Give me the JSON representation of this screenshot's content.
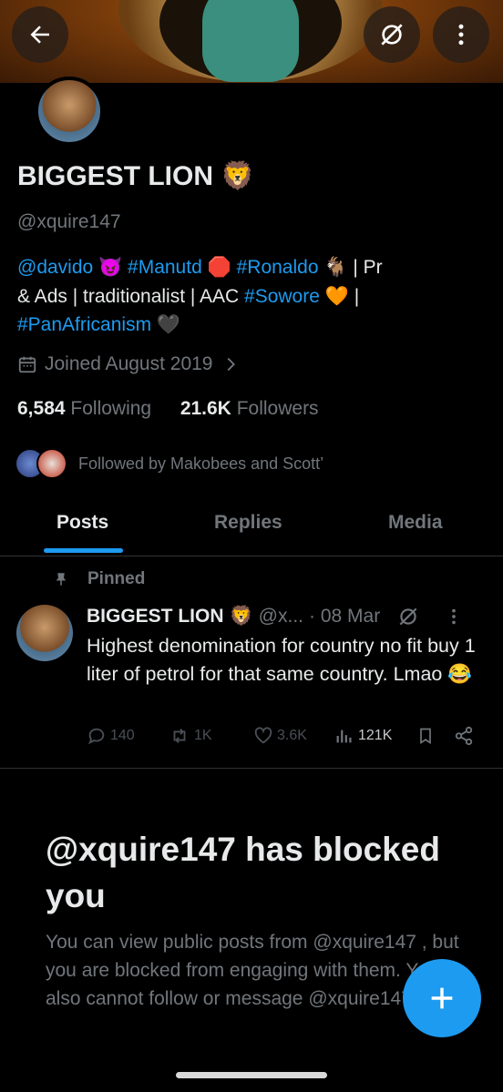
{
  "banner": {
    "back_icon": "arrow-left-icon",
    "hide_icon": "eye-slash-icon",
    "more_icon": "more-vertical-icon"
  },
  "profile": {
    "name": "BIGGEST LION",
    "name_emoji": "🦁",
    "handle": "@xquire147",
    "bio": {
      "line1": [
        {
          "t": "@davido",
          "link": true
        },
        {
          "t": " 😈 ",
          "link": false
        },
        {
          "t": "#Manutd",
          "link": true
        },
        {
          "t": " 🛑 ",
          "link": false
        },
        {
          "t": "#Ronaldo",
          "link": true
        },
        {
          "t": " 🐐 | Pr",
          "link": false
        }
      ],
      "line2": [
        {
          "t": "& Ads | traditionalist | AAC ",
          "link": false
        },
        {
          "t": "#Sowore",
          "link": true
        },
        {
          "t": " 🧡 |",
          "link": false
        }
      ],
      "line3": [
        {
          "t": "#PanAfricanism",
          "link": true
        },
        {
          "t": " 🖤",
          "link": false
        }
      ]
    },
    "joined": "Joined August 2019",
    "following_count": "6,584",
    "following_label": "Following",
    "followers_count": "21.6K",
    "followers_label": "Followers",
    "followed_by": "Followed by Makobees and Scott’"
  },
  "tabs": {
    "posts": "Posts",
    "replies": "Replies",
    "media": "Media"
  },
  "post": {
    "pinned_label": "Pinned",
    "author": "BIGGEST LION",
    "author_emoji": "🦁",
    "handle": "@x...",
    "date": "· 08 Mar",
    "text": "Highest denomination for country no fit buy 1 liter of petrol for that same country. Lmao 😂",
    "replies": "140",
    "reposts": "1K",
    "likes": "3.6K",
    "views": "121K"
  },
  "blocked": {
    "title": "@xquire147 has blocked you",
    "body": "You can view public posts from @xquire147 , but you are blocked from engaging with them. You also cannot follow or message @xquire147."
  },
  "colors": {
    "accent": "#1d9bf0",
    "muted": "#71767b",
    "text": "#e7e9ea"
  }
}
